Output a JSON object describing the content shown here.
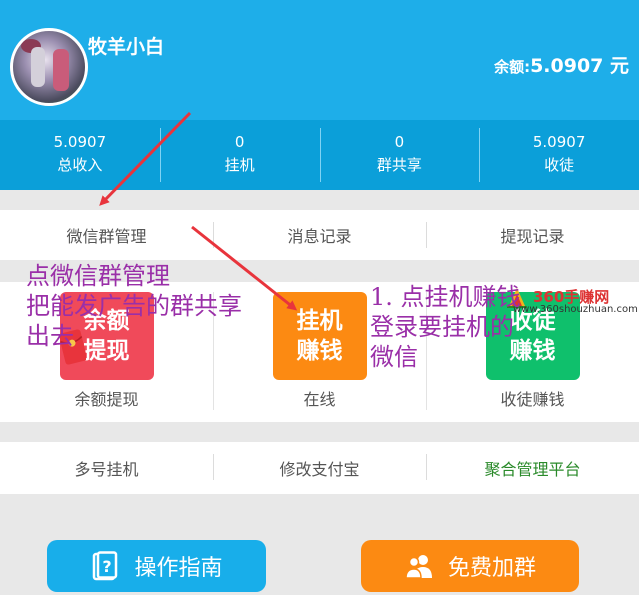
{
  "header": {
    "username": "牧羊小白",
    "balance_label": "余额:",
    "balance_value": "5.0907 元"
  },
  "stats": [
    {
      "value": "5.0907",
      "label": "总收入"
    },
    {
      "value": "0",
      "label": "挂机"
    },
    {
      "value": "0",
      "label": "群共享"
    },
    {
      "value": "5.0907",
      "label": "收徒"
    }
  ],
  "menu_row_1": [
    "微信群管理",
    "消息记录",
    "提现记录"
  ],
  "grid": [
    {
      "tile_line1": "余额",
      "tile_line2": "提现",
      "caption": "余额提现",
      "color": "#f04a5a"
    },
    {
      "tile_line1": "挂机",
      "tile_line2": "赚钱",
      "caption": "在线",
      "color": "#fc8a12"
    },
    {
      "tile_line1": "收徒",
      "tile_line2": "赚钱",
      "caption": "收徒赚钱",
      "color": "#0fc06c"
    }
  ],
  "menu_row_2": [
    "多号挂机",
    "修改支付宝",
    "聚合管理平台"
  ],
  "buttons": {
    "guide": "操作指南",
    "join_group": "免费加群"
  },
  "annotations": {
    "left_lines": [
      "点微信群管理",
      "把能发广告的群共享",
      "出去"
    ],
    "right_lines": [
      "1. 点挂机赚钱",
      "登录要挂机的",
      "微信"
    ]
  },
  "watermark": {
    "brand": "360手赚网",
    "url": "www.360shouzhuan.com"
  },
  "colors": {
    "header_bg": "#1eaee9",
    "stats_bg": "#0b9fd9",
    "annotation": "#9a2fa8",
    "arrow": "#e8343c"
  }
}
